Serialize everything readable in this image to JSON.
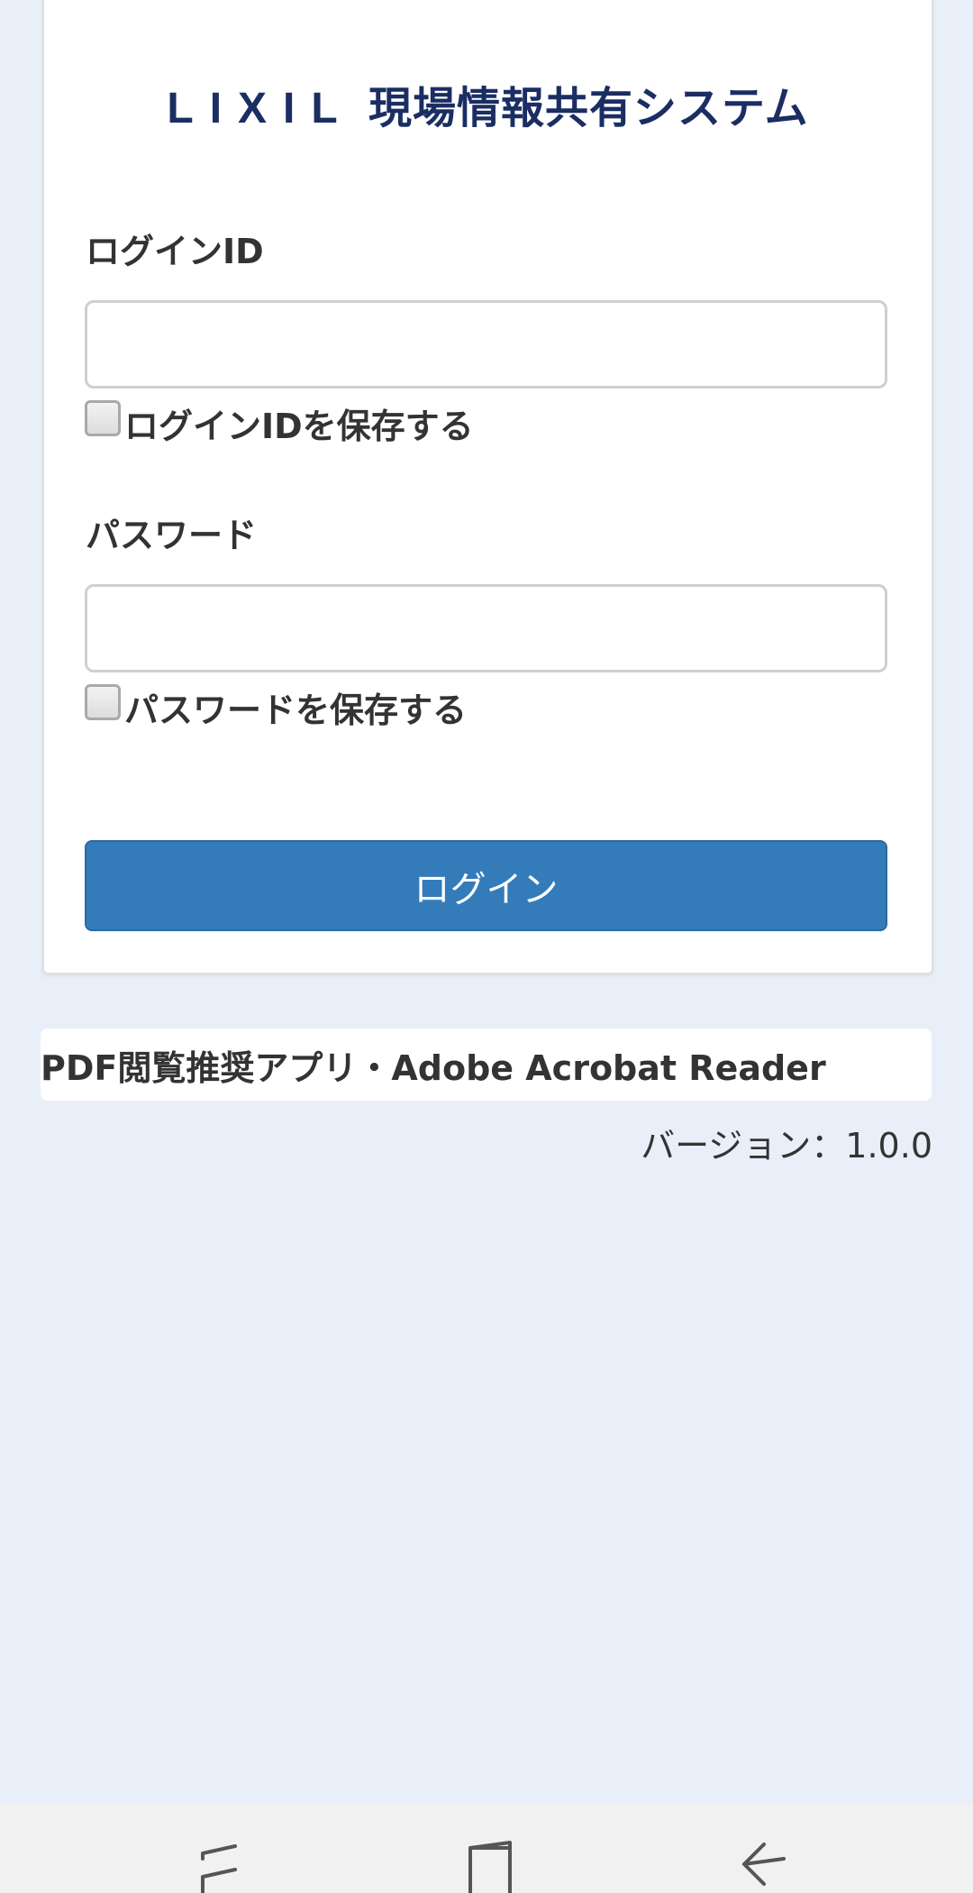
{
  "header": {
    "brand": "LIXIL",
    "system_name": "現場情報共有システム"
  },
  "form": {
    "login_id_label": "ログインID",
    "login_id_value": "",
    "save_login_id_label": "ログインIDを保存する",
    "password_label": "パスワード",
    "password_value": "",
    "save_password_label": "パスワードを保存する",
    "login_button_label": "ログイン"
  },
  "footer": {
    "pdf_recommendation": "PDF閲覧推奨アプリ・Adobe Acrobat Reader",
    "version": "バージョン：1.0.0"
  },
  "nav": {
    "recents_icon": "recent-apps-icon",
    "home_icon": "home-icon",
    "back_icon": "back-icon"
  },
  "colors": {
    "background": "#e9eff8",
    "brand_title": "#1b2e63",
    "button": "#347bba",
    "text": "#333333"
  }
}
